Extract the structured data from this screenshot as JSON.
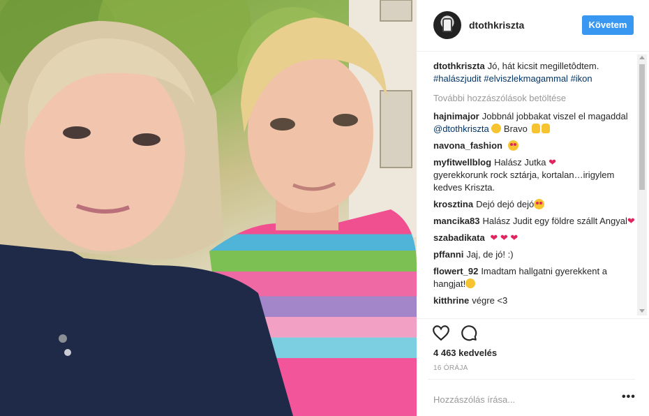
{
  "post": {
    "username": "dtothkriszta",
    "follow_label": "Követem",
    "caption": {
      "user": "dtothkriszta",
      "text": "Jó, hát kicsit megilletôdtem.",
      "tags": [
        "#halászjudit",
        "#elviszlekmagammal",
        "#ikon"
      ]
    },
    "load_more": "További hozzászólások betöltése",
    "comments": [
      {
        "user": "hajnimajor",
        "text": "Jobbnál jobbakat viszel el magaddal",
        "mention": "@dtothkriszta",
        "after": "Bravo"
      },
      {
        "user": "navona_fashion",
        "text": ""
      },
      {
        "user": "myfitwellblog",
        "text": "Halász Jutka",
        "text2": "gyerekkorunk rock sztárja, kortalan…irigylem kedves Kriszta."
      },
      {
        "user": "krosztina",
        "text": "Dejó dejó dejó"
      },
      {
        "user": "mancika83",
        "text": "Halász Judit egy földre szállt Angyal"
      },
      {
        "user": "szabadikata",
        "text": ""
      },
      {
        "user": "pffanni",
        "text": "Jaj, de jó! :)"
      },
      {
        "user": "flowert_92",
        "text": "Imadtam hallgatni gyerekkent a hangjat!"
      },
      {
        "user": "kitthrine",
        "text": "végre <3"
      }
    ],
    "likes": "4 463 kedvelés",
    "time_ago": "16 ÓRÁJA",
    "comment_placeholder": "Hozzászólás írása...",
    "more_label": "•••"
  },
  "colors": {
    "accent": "#3897f0",
    "heart": "#e0245e",
    "muted": "#999999",
    "hashtag": "#003569"
  },
  "icons": [
    "heart-icon",
    "comment-icon",
    "more-options-icon"
  ]
}
